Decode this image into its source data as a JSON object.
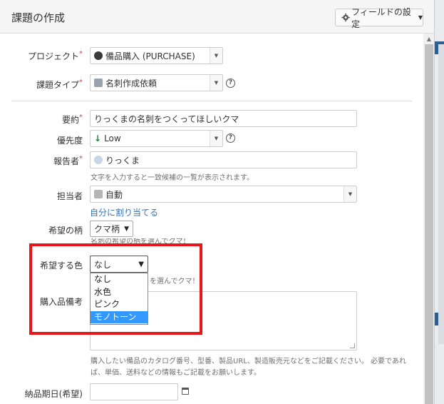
{
  "dialog": {
    "title": "課題の作成",
    "field_config_label": "フィールドの設定"
  },
  "fields": {
    "project": {
      "label": "プロジェクト",
      "value": "備品購入 (PURCHASE)"
    },
    "issue_type": {
      "label": "課題タイプ",
      "value": "名刺作成依頼"
    },
    "summary": {
      "label": "要約",
      "value": "りっくまの名刺をつくってほしいクマ"
    },
    "priority": {
      "label": "優先度",
      "value": "Low"
    },
    "reporter": {
      "label": "報告者",
      "value": "りっくま",
      "hint": "文字を入力すると一致候補の一覧が表示されます。"
    },
    "assignee": {
      "label": "担当者",
      "value": "自動",
      "assign_to_me": "自分に割り当てる"
    },
    "pattern": {
      "label": "希望の柄",
      "value": "クマ柄",
      "hint": "名刺の希望の柄を選んでクマ！"
    },
    "color": {
      "label": "希望する色",
      "value": "なし",
      "hint_visible": "を選んでクマ！",
      "options": [
        "なし",
        "水色",
        "ピンク",
        "モノトーン"
      ],
      "highlighted_option": "モノトーン"
    },
    "notes": {
      "label": "購入品備考",
      "hint": "購入したい備品のカタログ番号、型番、製品URL、製造販売元などをご記載ください。 必要であれば、単価、送料などの情報もご記載をお願いします。"
    },
    "due_date": {
      "label": "納品期日(希望)",
      "value": ""
    }
  },
  "colors": {
    "required": "#d04437",
    "link": "#3572b0",
    "highlight_box": "#e8151b",
    "selected_option": "#3399ff"
  }
}
